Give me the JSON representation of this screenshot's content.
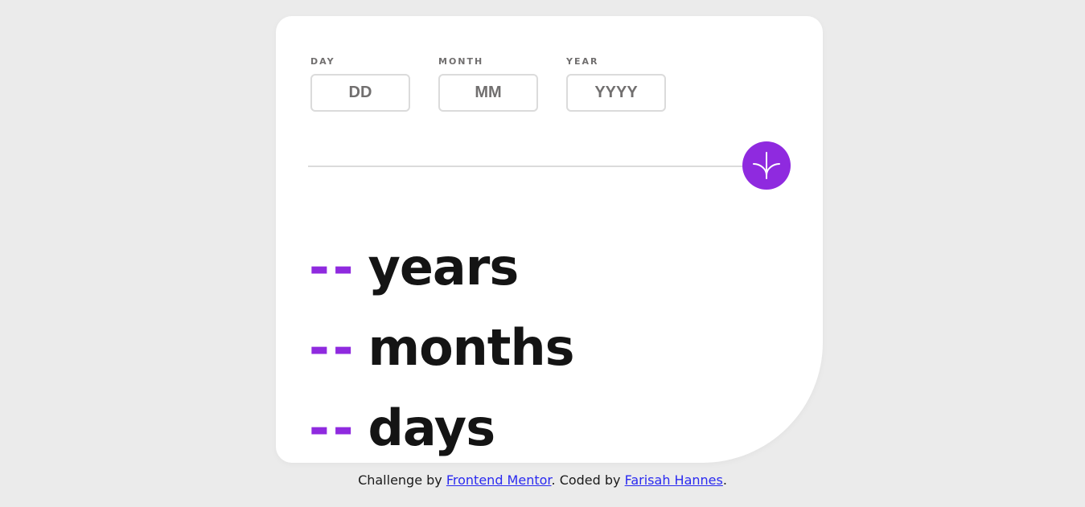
{
  "form": {
    "day": {
      "label": "DAY",
      "placeholder": "DD",
      "value": ""
    },
    "month": {
      "label": "MONTH",
      "placeholder": "MM",
      "value": ""
    },
    "year": {
      "label": "YEAR",
      "placeholder": "YYYY",
      "value": ""
    }
  },
  "submit": {
    "icon": "arrow-down-icon",
    "color": "#8f2adf"
  },
  "results": [
    {
      "value": "--",
      "unit": "years"
    },
    {
      "value": "--",
      "unit": "months"
    },
    {
      "value": "--",
      "unit": "days"
    }
  ],
  "footer": {
    "prefix": "Challenge by",
    "link1": "Frontend Mentor",
    "middle": ". Coded by",
    "link2": "Farisah Hannes",
    "suffix": "."
  },
  "colors": {
    "accent": "#8f2adf",
    "background": "#ebebeb",
    "card": "#ffffff"
  }
}
